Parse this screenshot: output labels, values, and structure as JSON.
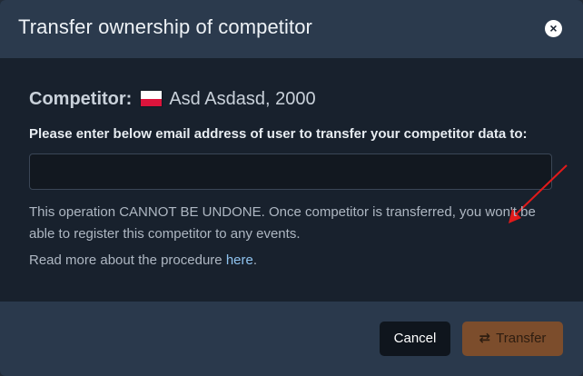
{
  "dialog": {
    "title": "Transfer ownership of competitor",
    "close_glyph": "×"
  },
  "competitor": {
    "label": "Competitor:",
    "flag": "poland-flag-icon",
    "value": "Asd Asdasd, 2000"
  },
  "form": {
    "instruction": "Please enter below email address of user to transfer your competitor data to:",
    "email_value": "",
    "email_placeholder": ""
  },
  "warning_text": "This operation CANNOT BE UNDONE. Once competitor is transferred, you won't be able to register this competitor to any events.",
  "readmore": {
    "prefix": "Read more about the procedure ",
    "link": "here",
    "suffix": "."
  },
  "footer": {
    "cancel_label": "Cancel",
    "transfer_label": "Transfer",
    "transfer_icon": "⇄"
  },
  "colors": {
    "accent_transfer": "#7c4d2c",
    "annotation_arrow": "#e11a1a",
    "link": "#8fc3ef"
  }
}
